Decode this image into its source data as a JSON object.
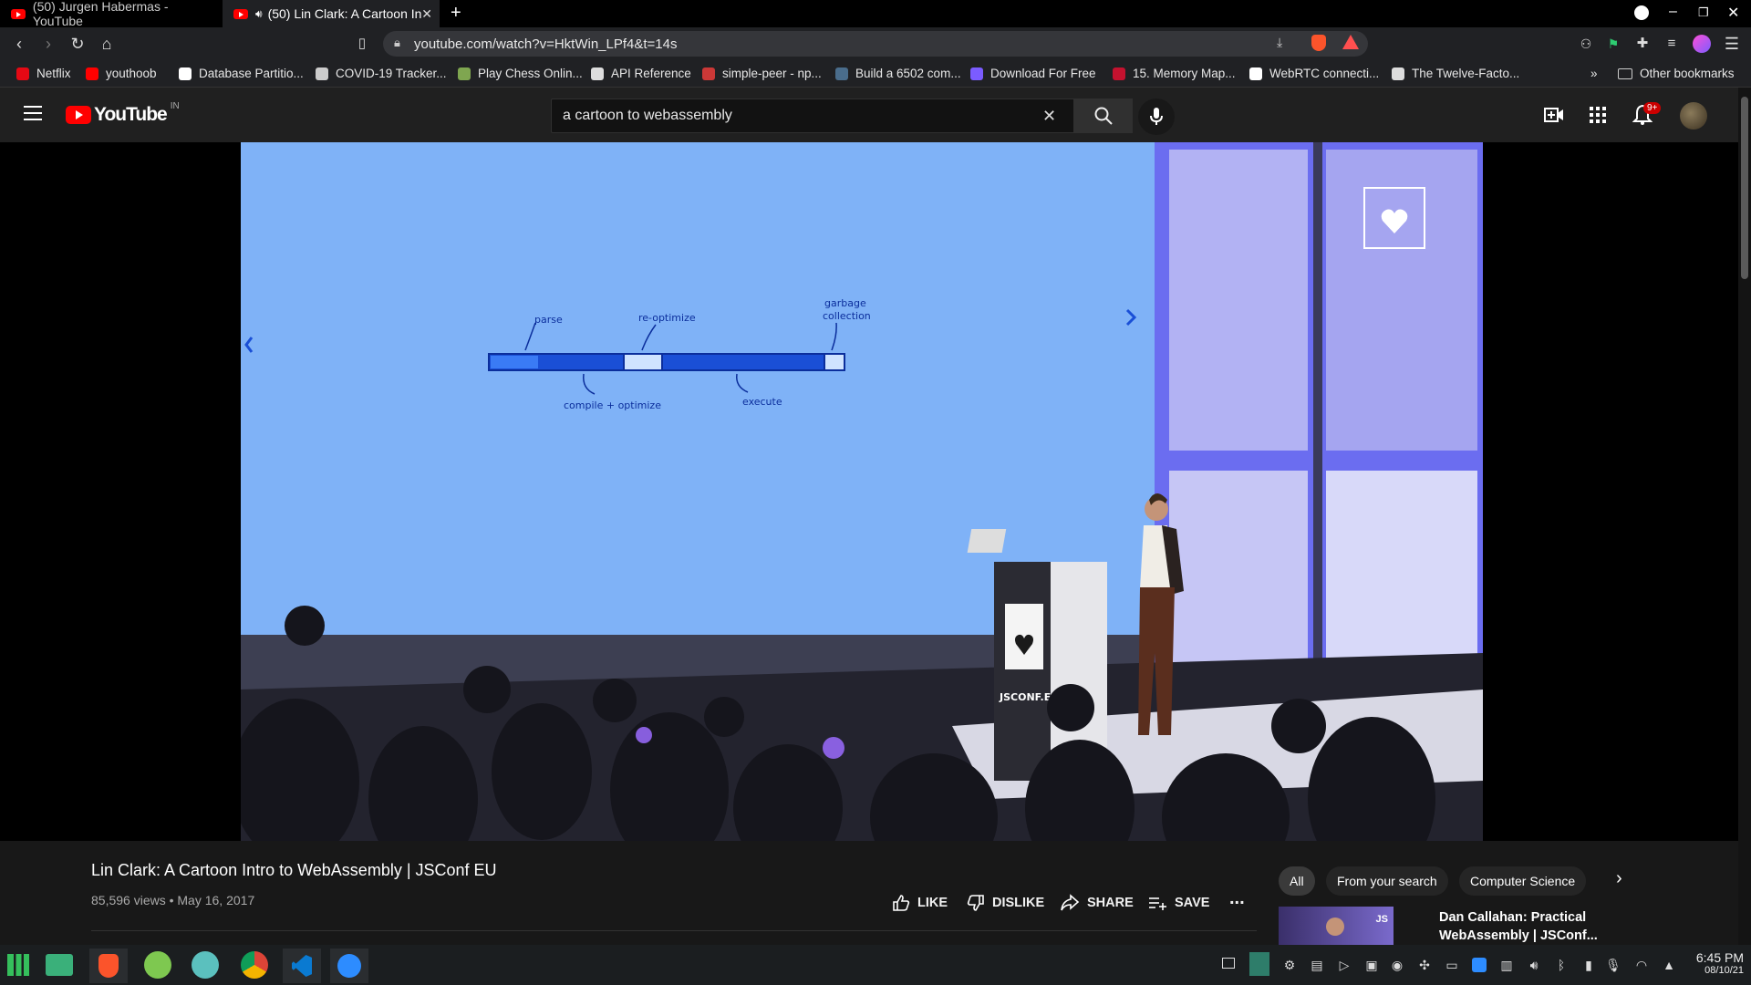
{
  "tabs": [
    {
      "title": "(50) Jurgen Habermas - YouTube",
      "active": false
    },
    {
      "title": "(50) Lin Clark: A Cartoon In",
      "active": true
    }
  ],
  "toolbar": {
    "url": "youtube.com/watch?v=HktWin_LPf4&t=14s"
  },
  "bookmarks": [
    {
      "label": "Netflix",
      "color": "#e50914"
    },
    {
      "label": "youthoob",
      "color": "#ff0000"
    },
    {
      "label": "Database Partitio...",
      "color": "#ffffff"
    },
    {
      "label": "COVID-19 Tracker...",
      "color": "#cccccc"
    },
    {
      "label": "Play Chess Onlin...",
      "color": "#7fa650"
    },
    {
      "label": "API Reference",
      "color": "#dddddd"
    },
    {
      "label": "simple-peer - np...",
      "color": "#cb3837"
    },
    {
      "label": "Build a 6502 com...",
      "color": "#4a6d8c"
    },
    {
      "label": "Download For Free",
      "color": "#7b5cff"
    },
    {
      "label": "15. Memory Map...",
      "color": "#c4122f"
    },
    {
      "label": "WebRTC connecti...",
      "color": "#ffffff"
    },
    {
      "label": "The Twelve-Facto...",
      "color": "#dddddd"
    }
  ],
  "bookmarks_overflow": "»",
  "other_bookmarks": "Other bookmarks",
  "youtube": {
    "logo_text": "YouTube",
    "region": "IN",
    "search_query": "a cartoon to webassembly",
    "notification_count": "9+"
  },
  "slide": {
    "parse": "parse",
    "reoptimize": "re-optimize",
    "garbage1": "garbage",
    "garbage2": "collection",
    "compile": "compile + optimize",
    "execute": "execute",
    "podium_brand": "JSCONF.EU"
  },
  "video": {
    "title": "Lin Clark: A Cartoon Intro to WebAssembly | JSConf EU",
    "meta": "85,596 views • May 16, 2017"
  },
  "actions": {
    "like": "LIKE",
    "dislike": "DISLIKE",
    "share": "SHARE",
    "save": "SAVE",
    "more": "..."
  },
  "chips": {
    "all": "All",
    "from_search": "From your search",
    "cs": "Computer Science"
  },
  "recommended": {
    "title_line1": "Dan Callahan: Practical",
    "title_line2": "WebAssembly | JSConf..."
  },
  "taskbar": {
    "time": "6:45 PM",
    "date": "08/10/21"
  },
  "colors": {
    "youtube_red": "#ff0000",
    "slide_blue": "#7fb2f7",
    "bar_blue": "#1a4fd6"
  }
}
